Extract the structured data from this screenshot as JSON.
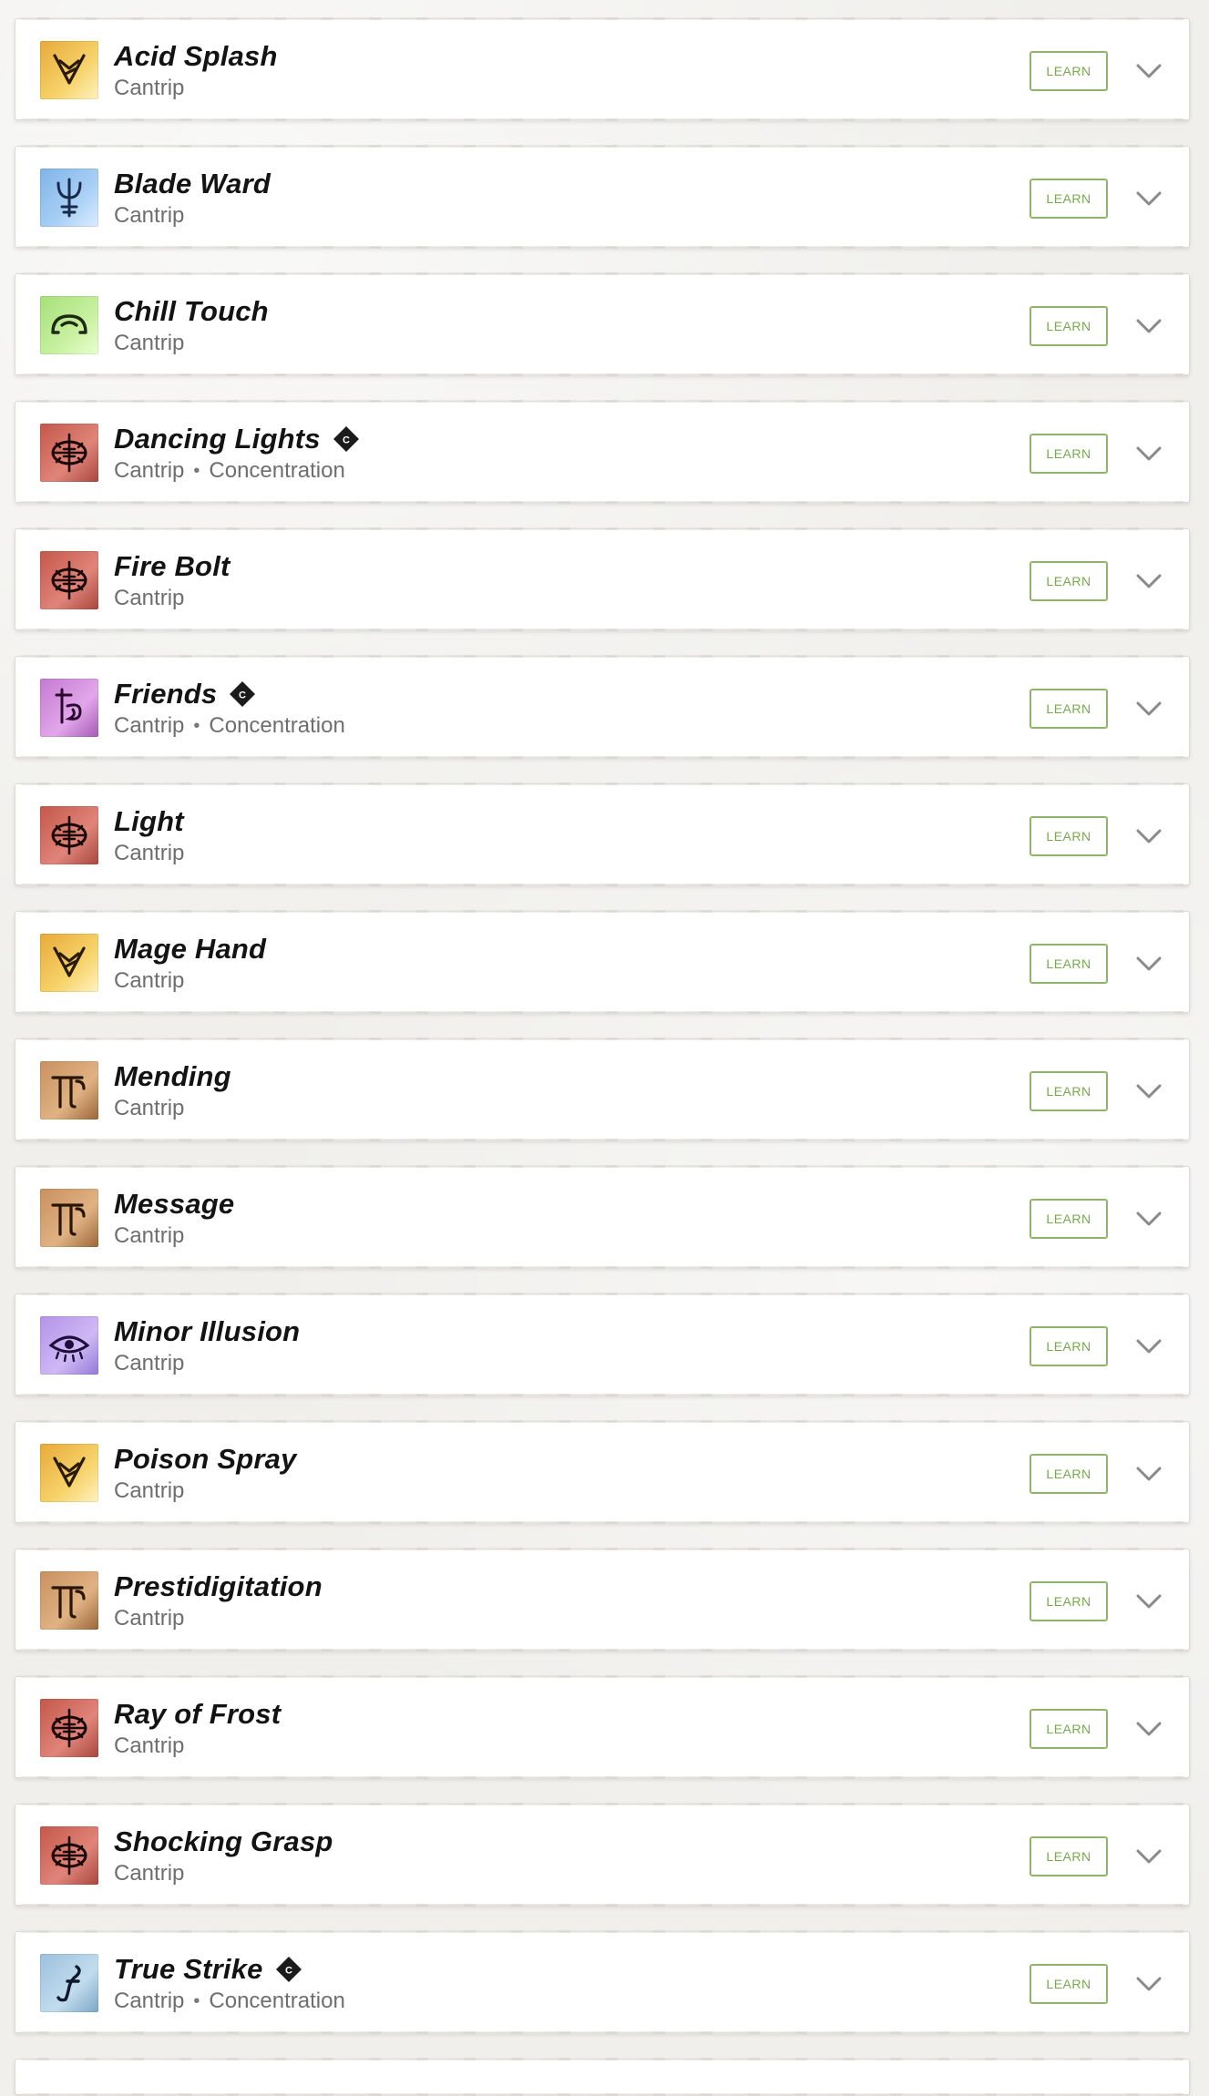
{
  "spells": [
    {
      "name": "Acid Splash",
      "level": "Cantrip",
      "concentration": false,
      "icon": "conjuration-icon",
      "learn_label": "LEARN"
    },
    {
      "name": "Blade Ward",
      "level": "Cantrip",
      "concentration": false,
      "icon": "abjuration-icon",
      "learn_label": "LEARN"
    },
    {
      "name": "Chill Touch",
      "level": "Cantrip",
      "concentration": false,
      "icon": "necromancy-icon",
      "learn_label": "LEARN"
    },
    {
      "name": "Dancing Lights",
      "level": "Cantrip",
      "concentration": true,
      "concentration_label": "Concentration",
      "icon": "evocation-icon",
      "learn_label": "LEARN"
    },
    {
      "name": "Fire Bolt",
      "level": "Cantrip",
      "concentration": false,
      "icon": "evocation-icon",
      "learn_label": "LEARN"
    },
    {
      "name": "Friends",
      "level": "Cantrip",
      "concentration": true,
      "concentration_label": "Concentration",
      "icon": "enchantment-icon",
      "learn_label": "LEARN"
    },
    {
      "name": "Light",
      "level": "Cantrip",
      "concentration": false,
      "icon": "evocation-icon",
      "learn_label": "LEARN"
    },
    {
      "name": "Mage Hand",
      "level": "Cantrip",
      "concentration": false,
      "icon": "conjuration-icon",
      "learn_label": "LEARN"
    },
    {
      "name": "Mending",
      "level": "Cantrip",
      "concentration": false,
      "icon": "transmutation-icon",
      "learn_label": "LEARN"
    },
    {
      "name": "Message",
      "level": "Cantrip",
      "concentration": false,
      "icon": "transmutation-icon",
      "learn_label": "LEARN"
    },
    {
      "name": "Minor Illusion",
      "level": "Cantrip",
      "concentration": false,
      "icon": "illusion-icon",
      "learn_label": "LEARN"
    },
    {
      "name": "Poison Spray",
      "level": "Cantrip",
      "concentration": false,
      "icon": "conjuration-icon",
      "learn_label": "LEARN"
    },
    {
      "name": "Prestidigitation",
      "level": "Cantrip",
      "concentration": false,
      "icon": "transmutation-icon",
      "learn_label": "LEARN"
    },
    {
      "name": "Ray of Frost",
      "level": "Cantrip",
      "concentration": false,
      "icon": "evocation-icon",
      "learn_label": "LEARN"
    },
    {
      "name": "Shocking Grasp",
      "level": "Cantrip",
      "concentration": false,
      "icon": "evocation-icon",
      "learn_label": "LEARN"
    },
    {
      "name": "True Strike",
      "level": "Cantrip",
      "concentration": true,
      "concentration_label": "Concentration",
      "icon": "divination-icon",
      "learn_label": "LEARN"
    }
  ],
  "concentration_badge": "C",
  "colors": {
    "learn_border": "#8fb56c",
    "learn_text": "#7aa852",
    "conjuration": "#e8a93a",
    "abjuration": "#7fb3e8",
    "necromancy": "#a6e07a",
    "evocation": "#c4574a",
    "enchantment": "#c47ad0",
    "transmutation": "#c99060",
    "illusion": "#b393e8",
    "divination": "#9cc0dc"
  }
}
